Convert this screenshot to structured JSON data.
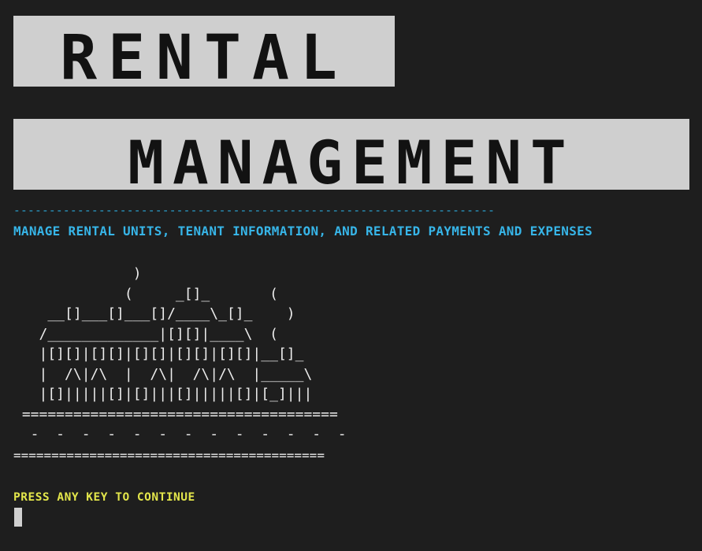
{
  "banner": {
    "line1": "RENTAL",
    "line2": "MANAGEMENT"
  },
  "divider": "--------------------------------------------------------------------",
  "subtitle": "MANAGE RENTAL UNITS, TENANT INFORMATION, AND RELATED PAYMENTS AND EXPENSES",
  "house_art": "              )\n             (     _[]_       (\n    __[]___[]___[]/____\\_[]_    )\n   /_____________|[][]|____\\  (\n   |[][]|[][]|[][]|[][]|[][]|__[]_\n   |  /\\|/\\  |  /\\|  /\\|/\\  |_____\\\n   |[]|||||[]|[]|||[]|||||[]|[_]|||\n =====================================\n  -  -  -  -  -  -  -  -  -  -  -  -  -",
  "bottom_rule": "=========================================",
  "prompt": "PRESS ANY KEY TO CONTINUE",
  "colors": {
    "background": "#1e1e1e",
    "banner_bg": "#cfcfcf",
    "banner_text": "#121212",
    "subtitle": "#37b5e8",
    "prompt": "#e3e64b"
  }
}
